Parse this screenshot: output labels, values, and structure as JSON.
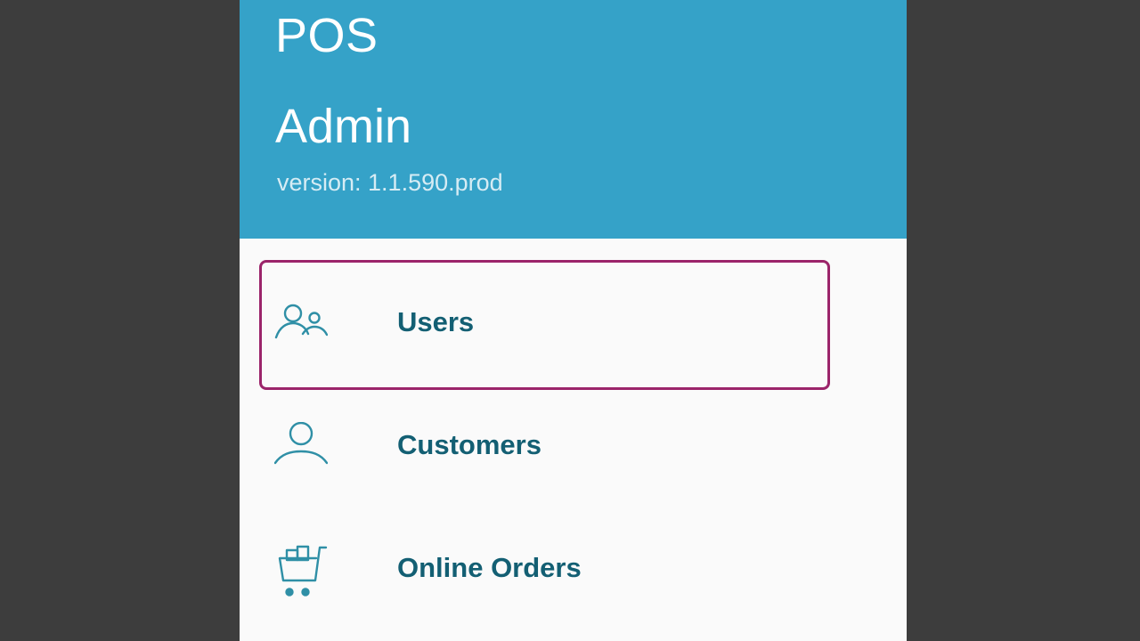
{
  "header": {
    "app_name": "POS",
    "role": "Admin",
    "version": "version: 1.1.590.prod",
    "background_color": "#35a2c8"
  },
  "menu": {
    "items": [
      {
        "label": "Users",
        "icon": "users-icon",
        "selected": true
      },
      {
        "label": "Customers",
        "icon": "customer-icon",
        "selected": false
      },
      {
        "label": "Online Orders",
        "icon": "shopping-cart-icon",
        "selected": false
      }
    ],
    "label_color": "#135f73",
    "selection_border_color": "#9b246a"
  }
}
